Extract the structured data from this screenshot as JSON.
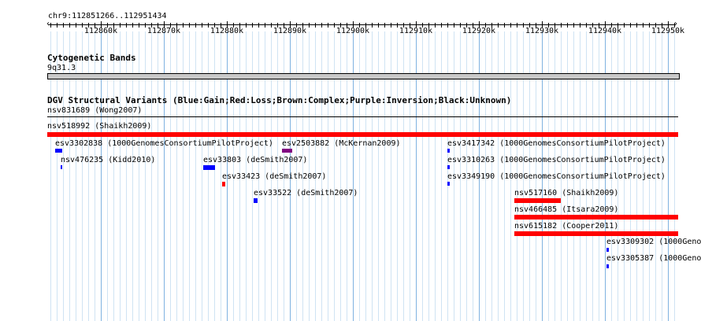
{
  "location": "chr9:112851266..112951434",
  "ruler": {
    "ticks": [
      "112860k",
      "112870k",
      "112880k",
      "112890k",
      "112900k",
      "112910k",
      "112920k",
      "112930k",
      "112940k",
      "112950k"
    ]
  },
  "cytobands": {
    "title": "Cytogenetic Bands",
    "band": "9q31.3"
  },
  "dgv": {
    "title": "DGV Structural Variants (Blue:Gain;Red:Loss;Brown:Complex;Purple:Inversion;Black:Unknown)",
    "variants": [
      {
        "label": "nsv831689 (Wong2007)",
        "color": "#000000"
      },
      {
        "label": "nsv518992 (Shaikh2009)",
        "color": "#ff0000"
      },
      {
        "label": "esv3302838 (1000GenomesConsortiumPilotProject)",
        "color": "#0000ff"
      },
      {
        "label": "esv2503882 (McKernan2009)",
        "color": "#800080"
      },
      {
        "label": "esv3417342 (1000GenomesConsortiumPilotProject)",
        "color": "#0000ff"
      },
      {
        "label": "nsv476235 (Kidd2010)",
        "color": "#0000ff"
      },
      {
        "label": "esv33803 (deSmith2007)",
        "color": "#0000ff"
      },
      {
        "label": "esv3310263 (1000GenomesConsortiumPilotProject)",
        "color": "#0000ff"
      },
      {
        "label": "esv33423 (deSmith2007)",
        "color": "#ff0000"
      },
      {
        "label": "esv3349190 (1000GenomesConsortiumPilotProject)",
        "color": "#0000ff"
      },
      {
        "label": "esv33522 (deSmith2007)",
        "color": "#0000ff"
      },
      {
        "label": "nsv517160 (Shaikh2009)",
        "color": "#ff0000"
      },
      {
        "label": "nsv466485 (Itsara2009)",
        "color": "#ff0000"
      },
      {
        "label": "nsv615182 (Cooper2011)",
        "color": "#ff0000"
      },
      {
        "label": "esv3309302 (1000Geno",
        "color": "#0000ff"
      },
      {
        "label": "esv3305387 (1000Geno",
        "color": "#0000ff"
      }
    ]
  }
}
